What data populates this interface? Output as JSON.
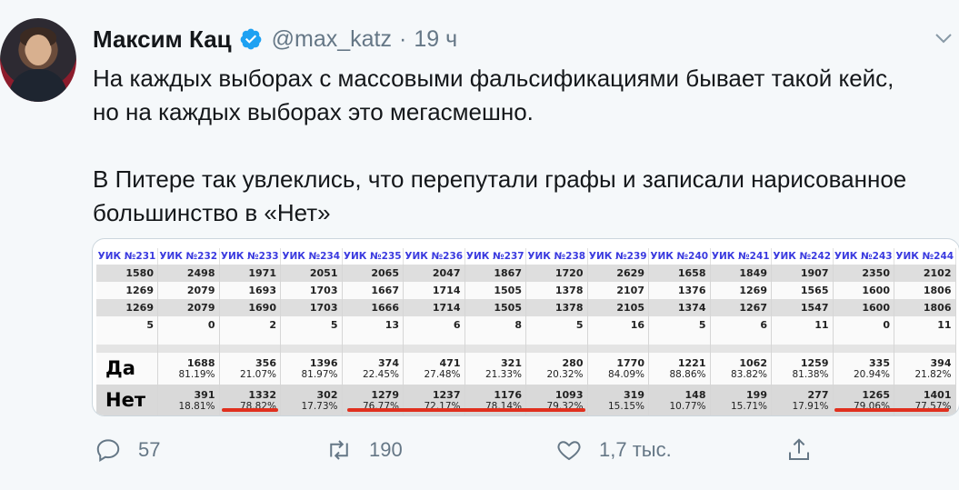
{
  "author": {
    "name": "Максим Кац",
    "handle": "@max_katz",
    "separator": "·",
    "time": "19 ч"
  },
  "tweet": {
    "lines_p1": [
      "На каждых выборах с массовыми фальсификациями бывает такой кейс,",
      "но на каждых выборах это мегасмешно."
    ],
    "lines_p2": [
      "В Питере так увлеклись, что перепутали графы и записали нарисованное",
      "большинство в «Нет»"
    ]
  },
  "table": {
    "headers": [
      "УИК №231",
      "УИК №232",
      "УИК №233",
      "УИК №234",
      "УИК №235",
      "УИК №236",
      "УИК №237",
      "УИК №238",
      "УИК №239",
      "УИК №240",
      "УИК №241",
      "УИК №242",
      "УИК №243",
      "УИК №244"
    ],
    "rows": [
      [
        "1580",
        "2498",
        "1971",
        "2051",
        "2065",
        "2047",
        "1867",
        "1720",
        "2629",
        "1658",
        "1849",
        "1907",
        "2350",
        "2102"
      ],
      [
        "1269",
        "2079",
        "1693",
        "1703",
        "1667",
        "1714",
        "1505",
        "1378",
        "2107",
        "1376",
        "1269",
        "1565",
        "1600",
        "1806"
      ],
      [
        "1269",
        "2079",
        "1690",
        "1703",
        "1666",
        "1714",
        "1505",
        "1378",
        "2105",
        "1374",
        "1267",
        "1547",
        "1600",
        "1806"
      ],
      [
        "5",
        "0",
        "2",
        "5",
        "13",
        "6",
        "8",
        "5",
        "16",
        "5",
        "6",
        "11",
        "0",
        "11"
      ]
    ],
    "yes_label": "Да",
    "no_label": "Нет",
    "yes": [
      {
        "v": "1688",
        "p": "81.19%"
      },
      {
        "v": "356",
        "p": "21.07%"
      },
      {
        "v": "1396",
        "p": "81.97%"
      },
      {
        "v": "374",
        "p": "22.45%"
      },
      {
        "v": "471",
        "p": "27.48%"
      },
      {
        "v": "321",
        "p": "21.33%"
      },
      {
        "v": "280",
        "p": "20.32%"
      },
      {
        "v": "1770",
        "p": "84.09%"
      },
      {
        "v": "1221",
        "p": "88.86%"
      },
      {
        "v": "1062",
        "p": "83.82%"
      },
      {
        "v": "1259",
        "p": "81.38%"
      },
      {
        "v": "335",
        "p": "20.94%"
      },
      {
        "v": "394",
        "p": "21.82%"
      }
    ],
    "no": [
      {
        "v": "391",
        "p": "18.81%"
      },
      {
        "v": "1332",
        "p": "78.82%"
      },
      {
        "v": "302",
        "p": "17.73%"
      },
      {
        "v": "1279",
        "p": "76.77%"
      },
      {
        "v": "1237",
        "p": "72.17%"
      },
      {
        "v": "1176",
        "p": "78.14%"
      },
      {
        "v": "1093",
        "p": "79.32%"
      },
      {
        "v": "319",
        "p": "15.15%"
      },
      {
        "v": "148",
        "p": "10.77%"
      },
      {
        "v": "199",
        "p": "15.71%"
      },
      {
        "v": "277",
        "p": "17.91%"
      },
      {
        "v": "1265",
        "p": "79.06%"
      },
      {
        "v": "1401",
        "p": "77.57%"
      }
    ],
    "highlight_color": "#e0301e"
  },
  "actions": {
    "replies": "57",
    "retweets": "190",
    "likes": "1,7 тыс."
  },
  "colors": {
    "verified": "#1da1f2",
    "muted": "#657786",
    "link_blue": "#3a3adf"
  }
}
